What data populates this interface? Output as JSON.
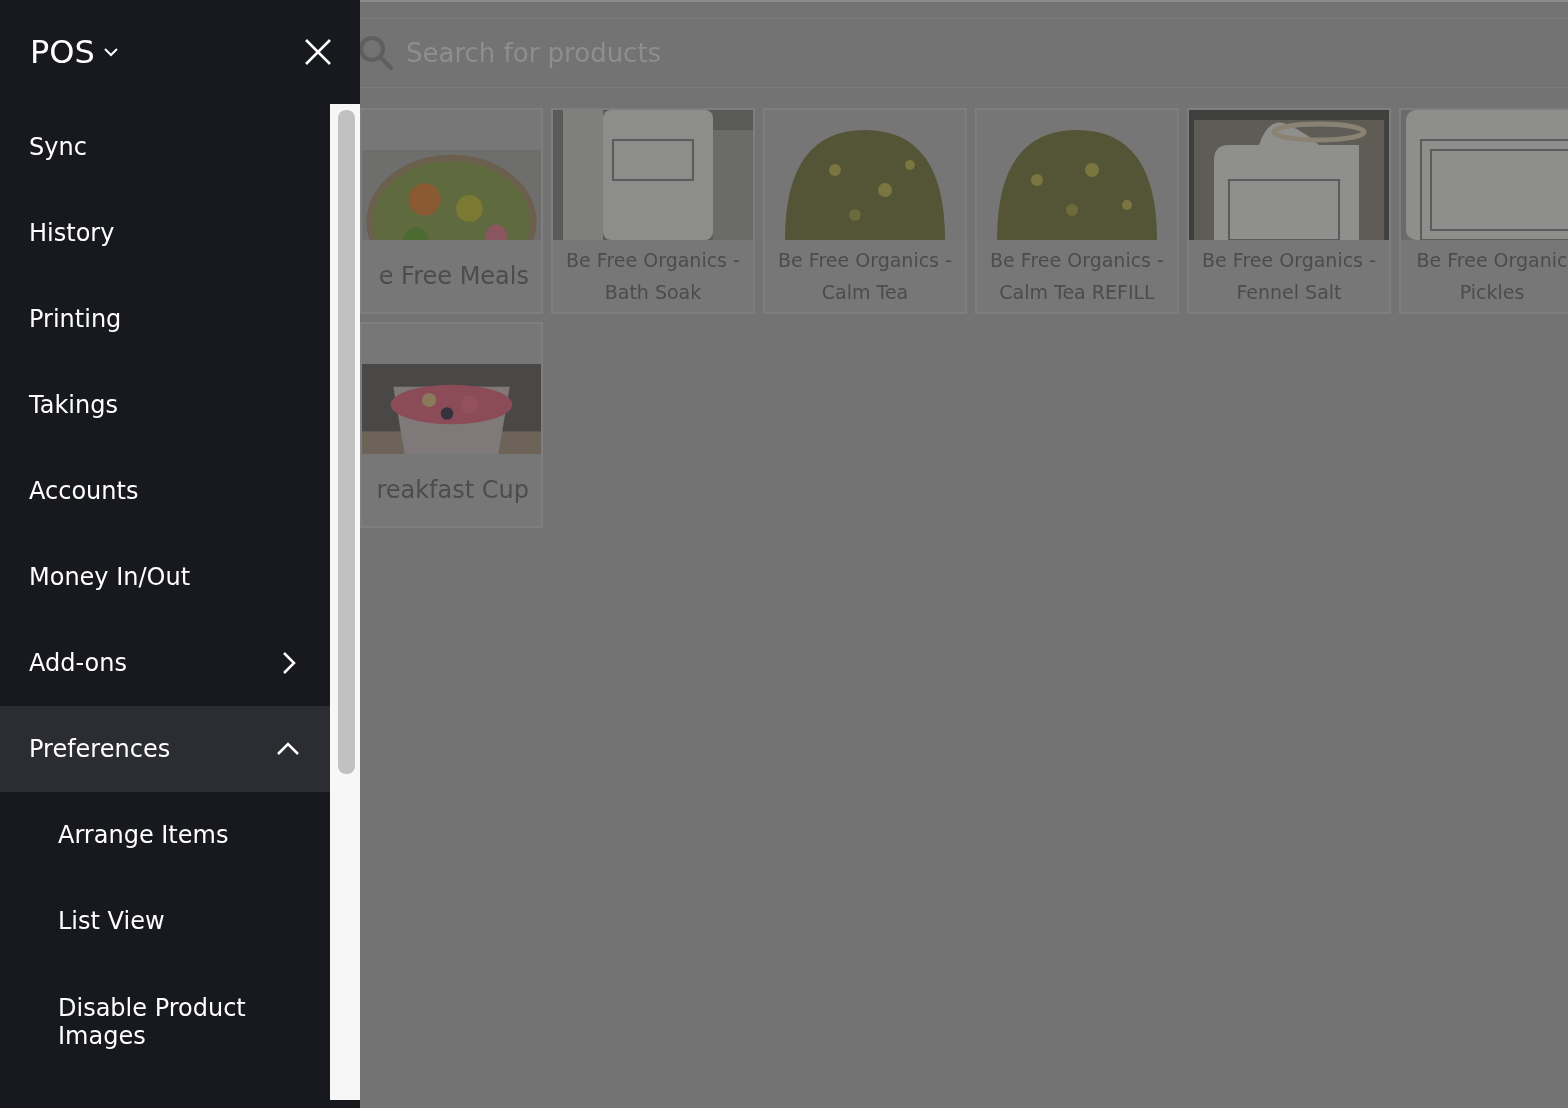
{
  "drawer": {
    "title": "POS",
    "items": [
      {
        "label": "Sync",
        "kind": "link"
      },
      {
        "label": "History",
        "kind": "link"
      },
      {
        "label": "Printing",
        "kind": "link"
      },
      {
        "label": "Takings",
        "kind": "link"
      },
      {
        "label": "Accounts",
        "kind": "link"
      },
      {
        "label": "Money In/Out",
        "kind": "link"
      },
      {
        "label": "Add-ons",
        "kind": "submenu",
        "expanded": false
      },
      {
        "label": "Preferences",
        "kind": "submenu",
        "expanded": true,
        "children": [
          {
            "label": "Arrange Items"
          },
          {
            "label": "List View"
          },
          {
            "label": "Disable Product Images"
          }
        ]
      }
    ]
  },
  "search": {
    "placeholder": "Search for products"
  },
  "products": [
    {
      "name": "e Free Meals",
      "kind": "picture"
    },
    {
      "name": "Be Free Organics - Bath Soak",
      "kind": "picture"
    },
    {
      "name": "Be Free Organics - Calm Tea",
      "kind": "picture"
    },
    {
      "name": "Be Free Organics - Calm Tea REFILL",
      "kind": "picture"
    },
    {
      "name": "Be Free Organics - Fennel Salt",
      "kind": "picture"
    },
    {
      "name": "Be Free Organic Pickles",
      "kind": "picture"
    },
    {
      "name": "reakfast Cup",
      "kind": "picture"
    }
  ]
}
